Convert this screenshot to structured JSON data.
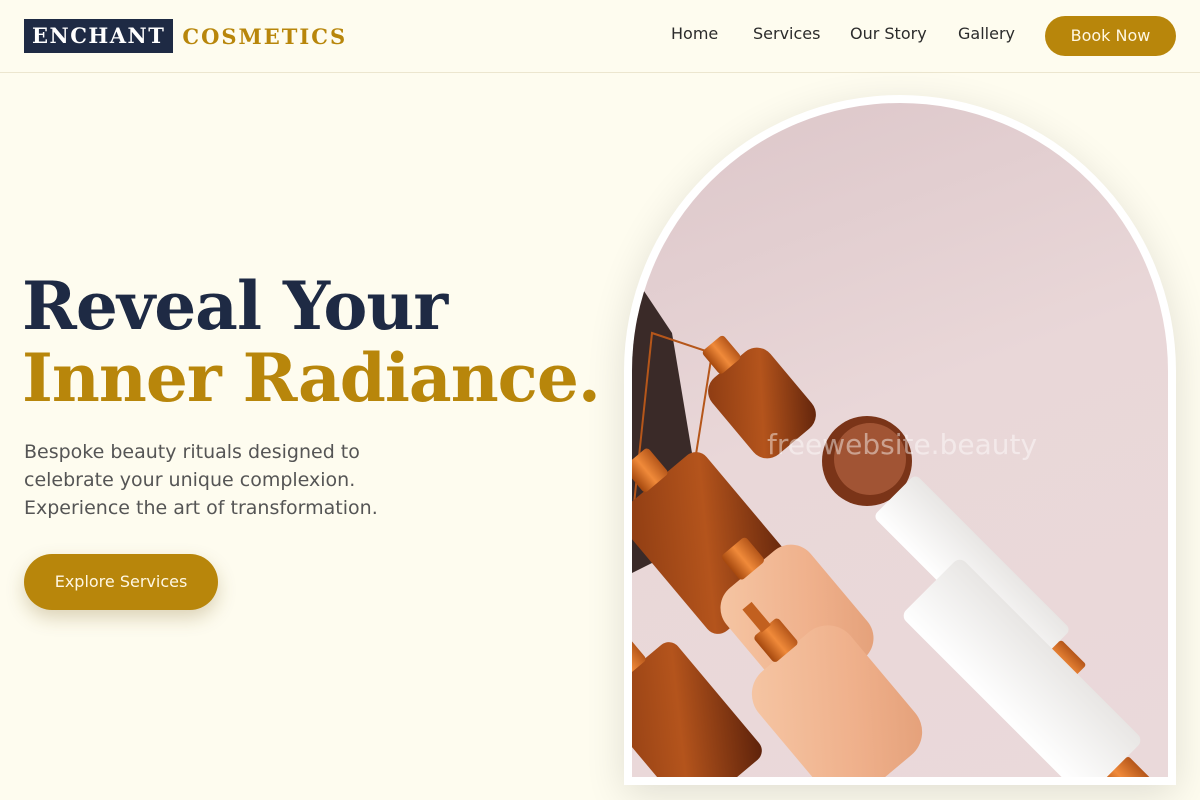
{
  "brand": {
    "name_dark": "ENCHANT",
    "name_gold": "COSMETICS"
  },
  "nav": {
    "items": [
      {
        "label": "Home"
      },
      {
        "label": "Services"
      },
      {
        "label": "Our Story"
      },
      {
        "label": "Gallery"
      }
    ],
    "cta": "Book Now"
  },
  "hero": {
    "title_line1": "Reveal Your",
    "title_line2": "Inner Radiance.",
    "subtitle": "Bespoke beauty rituals designed to celebrate your unique complexion. Experience the art of transformation.",
    "cta": "Explore Services",
    "image": {
      "alt": "Cosmetic bottles and tubes on pink background",
      "watermark": "freewebsite.beauty"
    }
  },
  "colors": {
    "navy": "#1e2a44",
    "gold": "#b8860b",
    "cream": "#fefcef",
    "blush": "#e9d7d8"
  }
}
